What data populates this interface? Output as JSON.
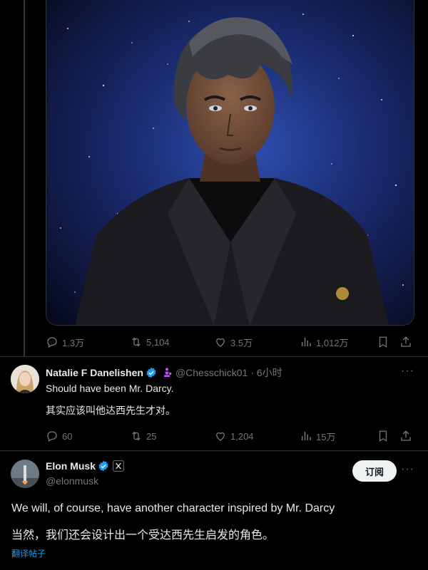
{
  "main_post": {
    "image_alt": "anime portrait of a man in a black suit against a starry blue background",
    "actions": {
      "replies": "1.3万",
      "reposts": "5,104",
      "likes": "3.5万",
      "views": "1,012万"
    }
  },
  "reply1": {
    "name": "Natalie F Danelishen",
    "handle": "@Chesschick01",
    "time": "· 6小时",
    "text": "Should have been Mr. Darcy.",
    "translation": "其实应该叫他达西先生才对。",
    "actions": {
      "replies": "60",
      "reposts": "25",
      "likes": "1,204",
      "views": "15万"
    }
  },
  "reply2": {
    "name": "Elon Musk",
    "handle": "@elonmusk",
    "subscribe_label": "订阅",
    "text": "We will, of course, have another character inspired by Mr. Darcy",
    "translation": "当然，我们还会设计出一个受达西先生启发的角色。",
    "translate_label": "翻译帖子"
  },
  "colors": {
    "background": "#000000",
    "text": "#e7e9ea",
    "muted": "#71767b",
    "verified": "#1d9bf0",
    "accent_pink": "#c950ff",
    "divider": "#2f3336"
  }
}
